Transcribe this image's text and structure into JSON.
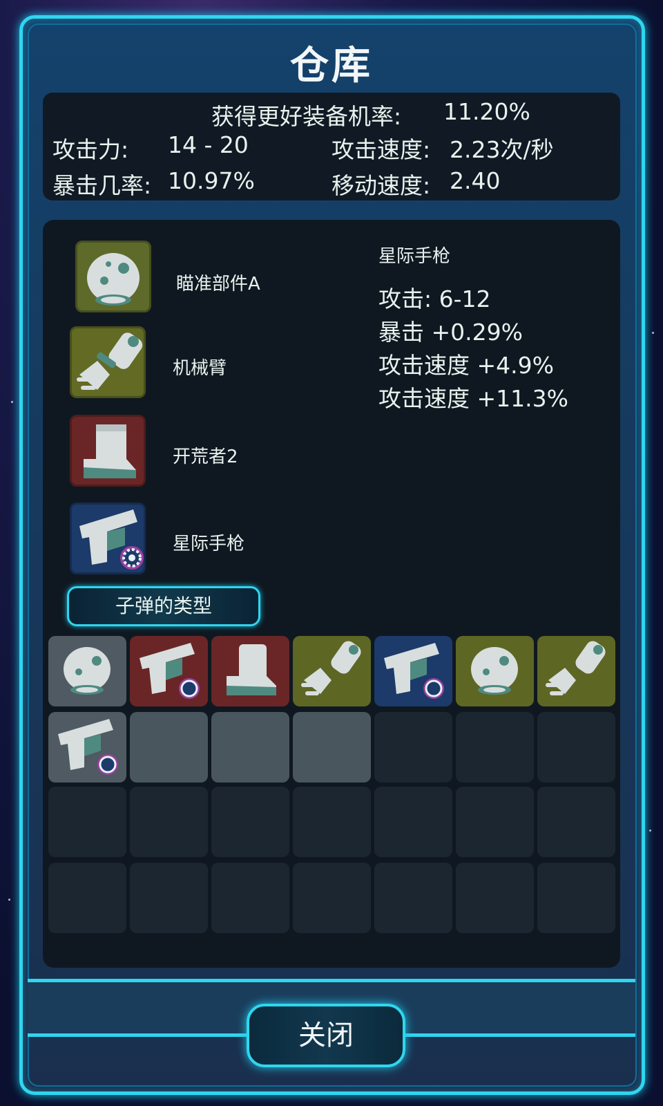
{
  "window": {
    "title": "仓库"
  },
  "stats": {
    "better_equip_label": "获得更好装备机率:",
    "better_equip_value": "11.20%",
    "attack_label": "攻击力:",
    "attack_value": "14 - 20",
    "attack_speed_label": "攻击速度:",
    "attack_speed_value": "2.23次/秒",
    "crit_label": "暴击几率:",
    "crit_value": "10.97%",
    "move_speed_label": "移动速度:",
    "move_speed_value": "2.40"
  },
  "equipped": [
    {
      "name": "瞄准部件A",
      "icon": "helmet-icon",
      "color": "#5e6a2a"
    },
    {
      "name": "机械臂",
      "icon": "mech-arm-icon",
      "color": "#626a24"
    },
    {
      "name": "开荒者2",
      "icon": "boot-icon",
      "color": "#6a2626"
    },
    {
      "name": "星际手枪",
      "icon": "pistol-icon",
      "color": "#1c3a6a"
    }
  ],
  "detail": {
    "name": "星际手枪",
    "lines": [
      "攻击: 6-12",
      "暴击 +0.29%",
      "攻击速度 +4.9%",
      "攻击速度 +11.3%"
    ]
  },
  "bullet_button": {
    "label": "子弹的类型"
  },
  "inventory": {
    "row1": [
      {
        "icon": "helmet-icon",
        "color": "#4f5a62"
      },
      {
        "icon": "pistol-icon",
        "color": "#6a2626"
      },
      {
        "icon": "boot-icon",
        "color": "#6a2626"
      },
      {
        "icon": "mech-arm-icon",
        "color": "#5e6624"
      },
      {
        "icon": "pistol-icon",
        "color": "#1c3a6a"
      },
      {
        "icon": "helmet-icon",
        "color": "#5e6624"
      },
      {
        "icon": "mech-arm-icon",
        "color": "#5e6624"
      }
    ],
    "row2_first": {
      "icon": "pistol-icon",
      "color": "#4f5a62"
    }
  },
  "close_button": {
    "label": "关闭"
  }
}
